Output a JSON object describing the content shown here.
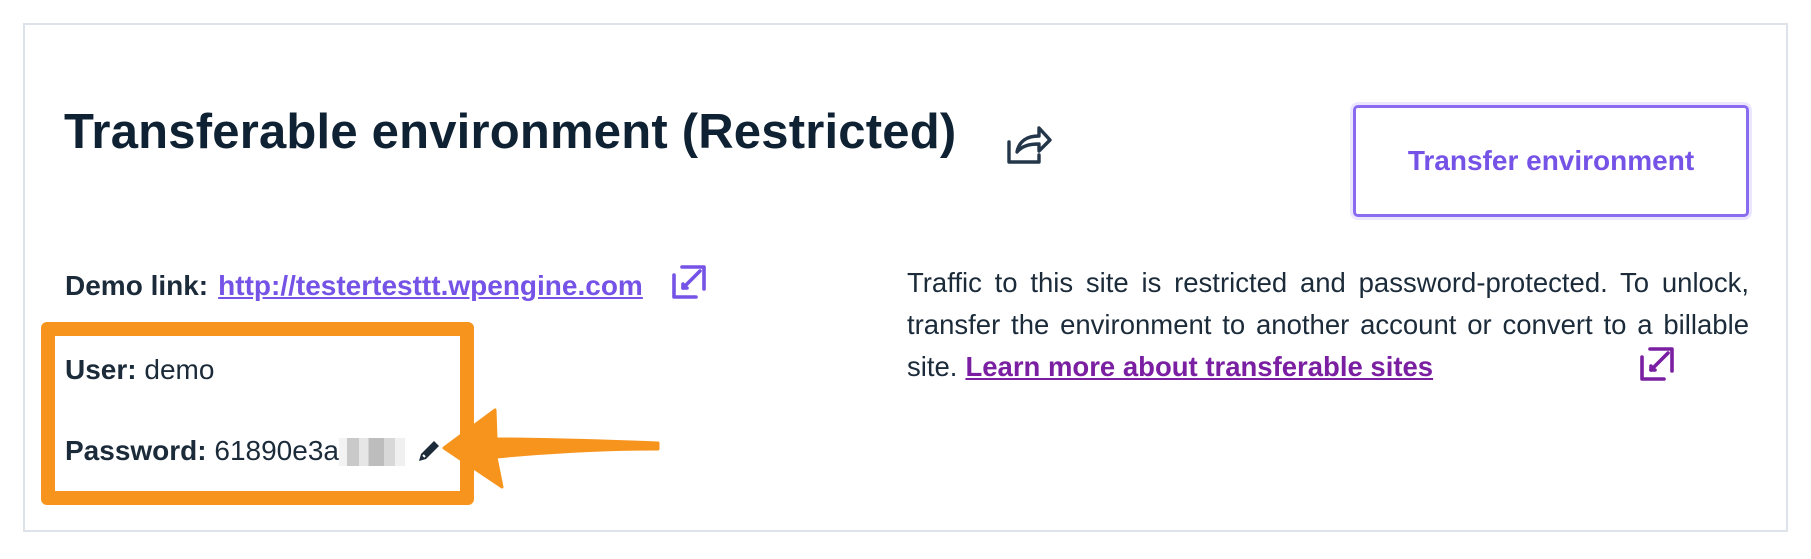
{
  "header": {
    "title": "Transferable environment (Restricted)",
    "share_icon": "share-icon",
    "transfer_button_label": "Transfer environment"
  },
  "details": {
    "demo_label": "Demo link:",
    "demo_url": "http://testertesttt.wpengine.com",
    "user_label": "User:",
    "user_value": "demo",
    "password_label": "Password:",
    "password_value": "61890e3a",
    "password_redacted": true,
    "edit_icon": "pencil-icon",
    "external_icon": "external-link-icon"
  },
  "description": {
    "text": "Traffic to this site is restricted and password-protected. To unlock, transfer the environment to another account or convert to a billable site.",
    "learn_more_label": "Learn more about transferable sites"
  },
  "annotation": {
    "highlight_color": "#f7941d",
    "arrow_icon": "arrow-left-icon"
  },
  "colors": {
    "accent": "#7553e6",
    "link_purple": "#7a1fa2",
    "text": "#1b2b3a"
  }
}
